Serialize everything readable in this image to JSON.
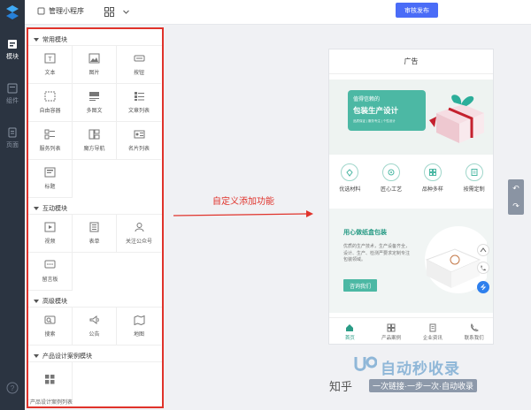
{
  "topbar": {
    "title": "管理小程序",
    "publish_label": "审核发布"
  },
  "rail": [
    {
      "label": "模块",
      "icon": "module-icon",
      "active": true
    },
    {
      "label": "组件",
      "icon": "component-icon",
      "active": false
    },
    {
      "label": "页面",
      "icon": "page-icon",
      "active": false
    }
  ],
  "panel": {
    "sections": [
      {
        "title": "常用模块",
        "items": [
          {
            "label": "文本",
            "icon": "text-icon"
          },
          {
            "label": "图片",
            "icon": "image-icon"
          },
          {
            "label": "按钮",
            "icon": "button-icon"
          },
          {
            "label": "自由容器",
            "icon": "container-icon"
          },
          {
            "label": "多图文",
            "icon": "multi-image-text-icon"
          },
          {
            "label": "文章列表",
            "icon": "article-list-icon"
          },
          {
            "label": "服务列表",
            "icon": "service-list-icon"
          },
          {
            "label": "魔方导航",
            "icon": "cube-nav-icon"
          },
          {
            "label": "名片列表",
            "icon": "card-list-icon"
          },
          {
            "label": "标题",
            "icon": "heading-icon"
          }
        ]
      },
      {
        "title": "互动模块",
        "items": [
          {
            "label": "视频",
            "icon": "video-icon"
          },
          {
            "label": "表单",
            "icon": "form-icon"
          },
          {
            "label": "关注公众号",
            "icon": "follow-icon"
          },
          {
            "label": "留言板",
            "icon": "message-board-icon"
          }
        ]
      },
      {
        "title": "高级模块",
        "items": [
          {
            "label": "搜索",
            "icon": "search-icon"
          },
          {
            "label": "公告",
            "icon": "announcement-icon"
          },
          {
            "label": "地图",
            "icon": "map-icon"
          }
        ]
      },
      {
        "title": "产品设计案例模块",
        "items": [
          {
            "label": "",
            "icon": "grid-icon"
          }
        ]
      }
    ],
    "footer": "产品设计案例列表"
  },
  "annotation": {
    "text": "自定义添加功能"
  },
  "preview": {
    "title": "广告",
    "banner": {
      "line1": "值得信赖的",
      "line2": "包装生产设计",
      "line3": "品质保证 | 服务专注 | 个性设计"
    },
    "features": [
      {
        "label": "优选材料",
        "icon": "material-icon"
      },
      {
        "label": "匠心工艺",
        "icon": "craft-icon"
      },
      {
        "label": "品种多样",
        "icon": "variety-icon"
      },
      {
        "label": "按需定制",
        "icon": "custom-icon"
      }
    ],
    "promo": {
      "title": "用心做纸盒包装",
      "desc": "优质的生产技术，生产设备齐全，设计、生产、检测严要求定制专注包装领域。",
      "button": "咨询我们"
    },
    "tabs": [
      {
        "label": "首页",
        "icon": "home-icon",
        "active": true
      },
      {
        "label": "产品案例",
        "icon": "product-icon",
        "active": false
      },
      {
        "label": "企业资讯",
        "icon": "news-icon",
        "active": false
      },
      {
        "label": "联系我们",
        "icon": "contact-icon",
        "active": false
      }
    ]
  },
  "watermark": {
    "brand": "自动秒收录",
    "zh": "知乎",
    "sub": "一次链接·一步一次·自动收录"
  }
}
